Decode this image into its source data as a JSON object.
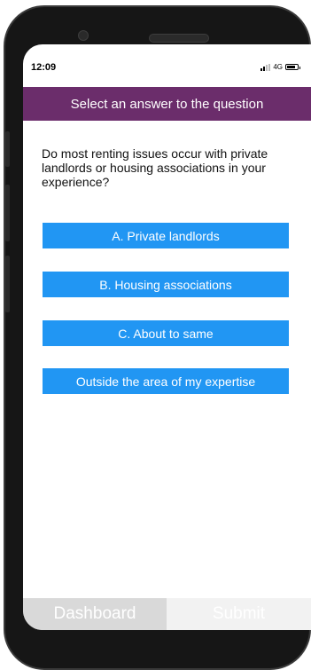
{
  "status_bar": {
    "time": "12:09",
    "network": "4G"
  },
  "header": {
    "title": "Select an answer to the question"
  },
  "question": {
    "text": "Do most renting issues occur with private landlords or housing associations in your experience?"
  },
  "answers": [
    {
      "label": "A. Private landlords"
    },
    {
      "label": "B. Housing associations"
    },
    {
      "label": "C. About to same"
    },
    {
      "label": "Outside the area of my expertise"
    }
  ],
  "footer": {
    "dashboard_label": "Dashboard",
    "submit_label": "Submit"
  },
  "colors": {
    "header": "#6b2d6b",
    "answer_button": "#2196f3",
    "dashboard_bg": "#d9d9d9",
    "submit_bg": "#f2f2f2"
  }
}
